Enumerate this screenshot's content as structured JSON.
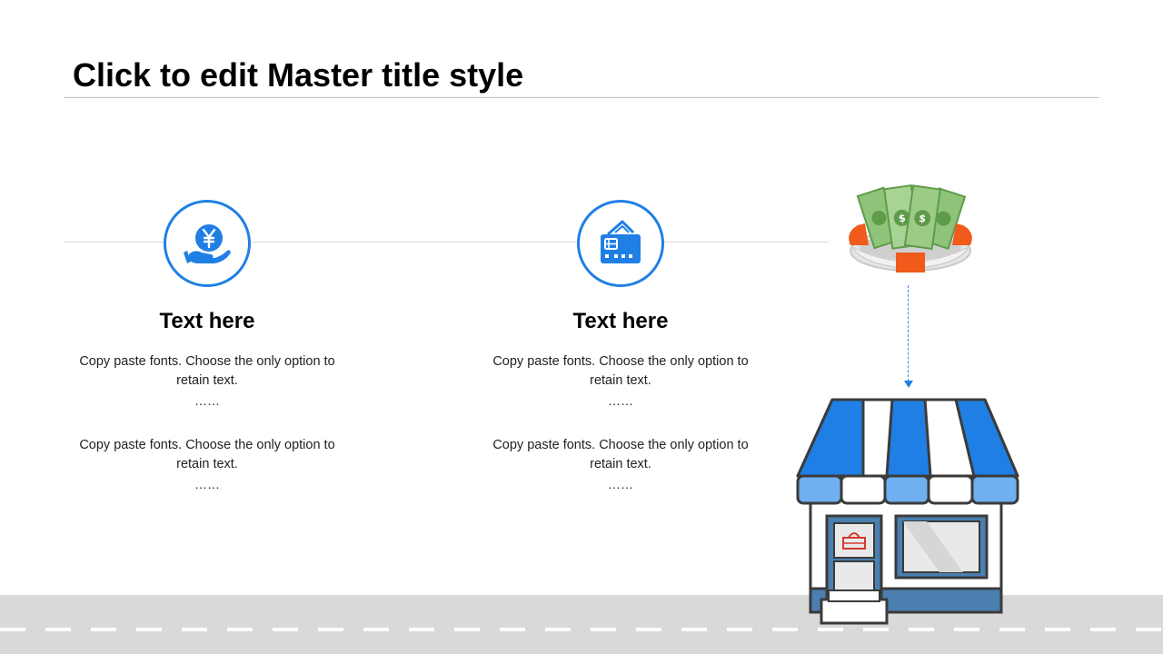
{
  "slide": {
    "title": "Click to edit Master title style"
  },
  "columns": [
    {
      "icon": "yen-hand-icon",
      "heading": "Text here",
      "paragraph_1": "Copy paste fonts. Choose the only option to retain text.",
      "dots_1": "……",
      "paragraph_2": "Copy paste fonts. Choose the only option to retain text.",
      "dots_2": "……"
    },
    {
      "icon": "credit-card-icon",
      "heading": "Text here",
      "paragraph_1": "Copy paste fonts. Choose the only option to retain text.",
      "dots_1": "……",
      "paragraph_2": "Copy paste fonts. Choose the only option to retain text.",
      "dots_2": "……"
    }
  ],
  "illustrations": {
    "top": "money-lifebuoy-icon",
    "bottom": "storefront-icon"
  },
  "colors": {
    "accent": "#1f7fe5",
    "awning_light": "#6fb0f0",
    "store_base": "#4a7fb0",
    "road": "#d9d9d9",
    "lifebuoy": "#f05a1a",
    "money": "#6aa84f"
  }
}
